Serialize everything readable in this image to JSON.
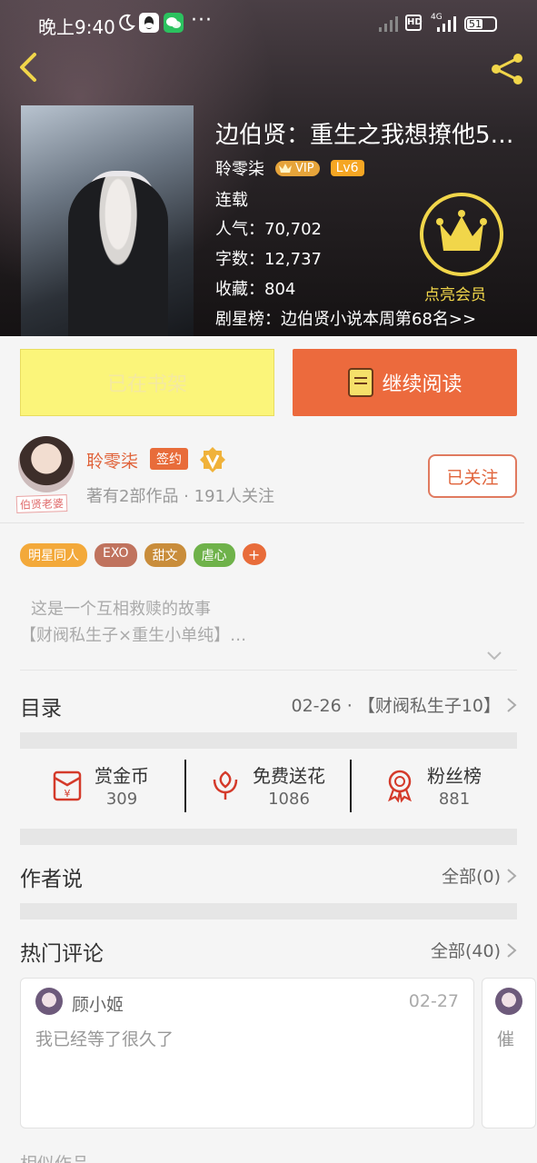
{
  "status_bar": {
    "time": "晚上9:40",
    "dots": "···",
    "network": "4G",
    "hd": "HD",
    "battery": "51"
  },
  "book": {
    "title": "边伯贤：重生之我想撩他5…",
    "author": "聆零柒",
    "vip_label": "VIP",
    "level": "Lv6",
    "status": "连载",
    "popularity": "人气：70,702",
    "words": "字数：12,737",
    "favorites": "收藏：804",
    "ranking": "剧星榜：边伯贤小说本周第68名>>",
    "member_label": "点亮会员"
  },
  "actions": {
    "shelf_label": "已在书架",
    "read_label": "继续阅读"
  },
  "author_card": {
    "name": "聆零柒",
    "sign_label": "签约",
    "avatar_tag": "伯贤老婆",
    "meta": "著有2部作品 · 191人关注",
    "follow_label": "已关注"
  },
  "tags": [
    {
      "label": "明星同人",
      "color": "#f3a93a"
    },
    {
      "label": "EXO",
      "color": "#c0735e"
    },
    {
      "label": "甜文",
      "color": "#c98d3b"
    },
    {
      "label": "虐心",
      "color": "#6fb24a"
    }
  ],
  "tag_plus": "+",
  "intro": {
    "line1": "这是一个互相救赎的故事",
    "line2": "【财阀私生子×重生小单纯】…"
  },
  "catalog": {
    "label": "目录",
    "latest": "02-26 · 【财阀私生子10】"
  },
  "stats": [
    {
      "label": "赏金币",
      "value": "309",
      "icon": "red-envelope-icon"
    },
    {
      "label": "免费送花",
      "value": "1086",
      "icon": "flower-icon"
    },
    {
      "label": "粉丝榜",
      "value": "881",
      "icon": "medal-icon"
    }
  ],
  "author_says": {
    "label": "作者说",
    "all": "全部(0)"
  },
  "hot_comments": {
    "label": "热门评论",
    "all": "全部(40)",
    "items": [
      {
        "name": "顾小姬",
        "date": "02-27",
        "text": "我已经等了很久了"
      },
      {
        "text": "催"
      }
    ]
  },
  "bottom_partial": "相似作品",
  "colors": {
    "accent": "#ec6a3d",
    "shelf": "#fbf57a",
    "gold": "#f1d64a"
  }
}
